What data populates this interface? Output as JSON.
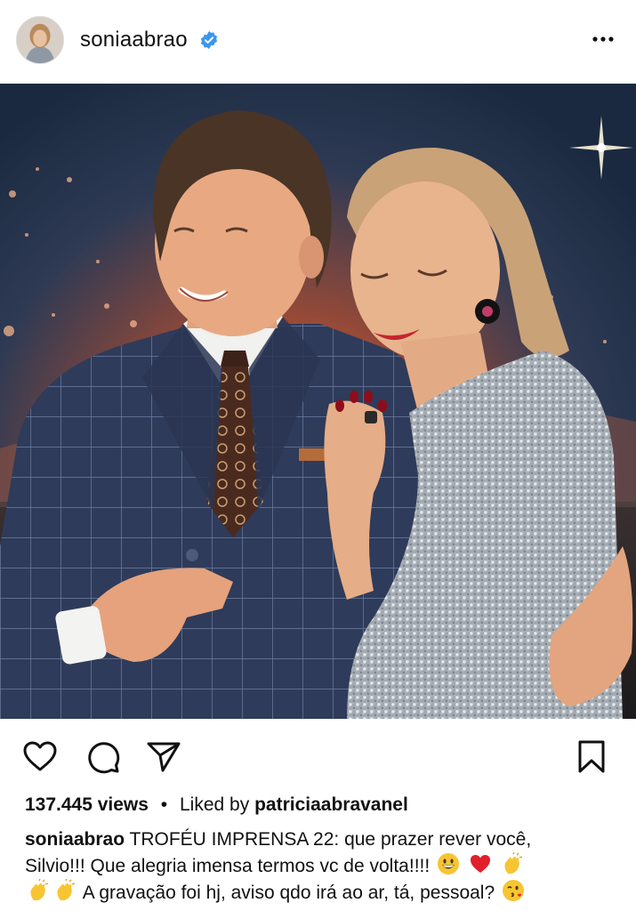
{
  "post": {
    "username": "sonia​abrao",
    "verified_icon": "verified-badge-icon",
    "more_icon": "more-horizontal-icon",
    "colors": {
      "verified": "#3897f0",
      "text": "#111111",
      "background": "#ffffff"
    }
  },
  "actions": {
    "like_icon": "heart-icon",
    "comment_icon": "comment-icon",
    "share_icon": "send-icon",
    "save_icon": "bookmark-icon",
    "mute_icon": "speaker-muted-icon"
  },
  "stats": {
    "views": "137.445 views",
    "separator": "•",
    "liked_by_prefix": "Liked by",
    "liked_by_user": "patriciaabravanel"
  },
  "caption": {
    "author": "sonia​abrao",
    "line1": "TROFÉU IMPRENSA 22: que prazer rever você,",
    "line2": "Silvio!!! Que alegria imensa termos vc de volta!!!!",
    "line3": "A gravação foi hj, aviso qdo irá ao ar, tá, pessoal?",
    "emojis": [
      "grinning-face",
      "red-heart",
      "clapping-hands",
      "clapping-hands",
      "clapping-hands",
      "face-blowing-kiss"
    ]
  }
}
